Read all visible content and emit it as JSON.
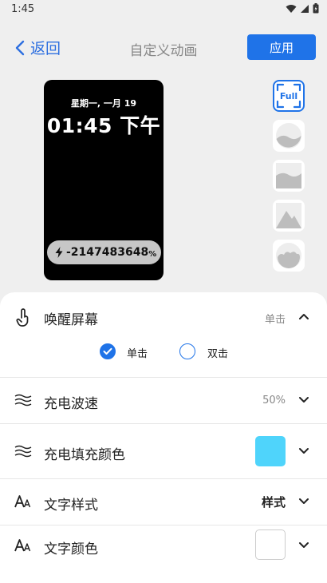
{
  "status_bar": {
    "time": "1:45"
  },
  "top_bar": {
    "back_label": "返回",
    "title": "自定义动画",
    "apply_label": "应用"
  },
  "preview": {
    "date": "星期一, 一月 19",
    "time": "01:45 下午",
    "battery_value": "-2147483648",
    "battery_unit": "%"
  },
  "style_options": [
    {
      "label": "Full",
      "selected": true
    },
    {
      "icon": "circle-wave-icon",
      "selected": false
    },
    {
      "icon": "square-wave-icon",
      "selected": false
    },
    {
      "icon": "mountain-icon",
      "selected": false
    },
    {
      "icon": "cloud-circle-icon",
      "selected": false
    }
  ],
  "settings": {
    "wake_screen": {
      "label": "唤醒屏幕",
      "value": "单击",
      "expanded": true,
      "options": [
        {
          "label": "单击",
          "checked": true
        },
        {
          "label": "双击",
          "checked": false
        }
      ]
    },
    "charge_wave_speed": {
      "label": "充电波速",
      "value": "50%"
    },
    "charge_fill_color": {
      "label": "充电填充颜色",
      "color": "#4fd4fb"
    },
    "text_style": {
      "label": "文字样式",
      "value": "样式"
    },
    "text_color": {
      "label": "文字颜色",
      "color": "#ffffff"
    }
  },
  "colors": {
    "accent": "#1f73e8",
    "panel": "#ffffff",
    "page_bg": "#efefef"
  }
}
